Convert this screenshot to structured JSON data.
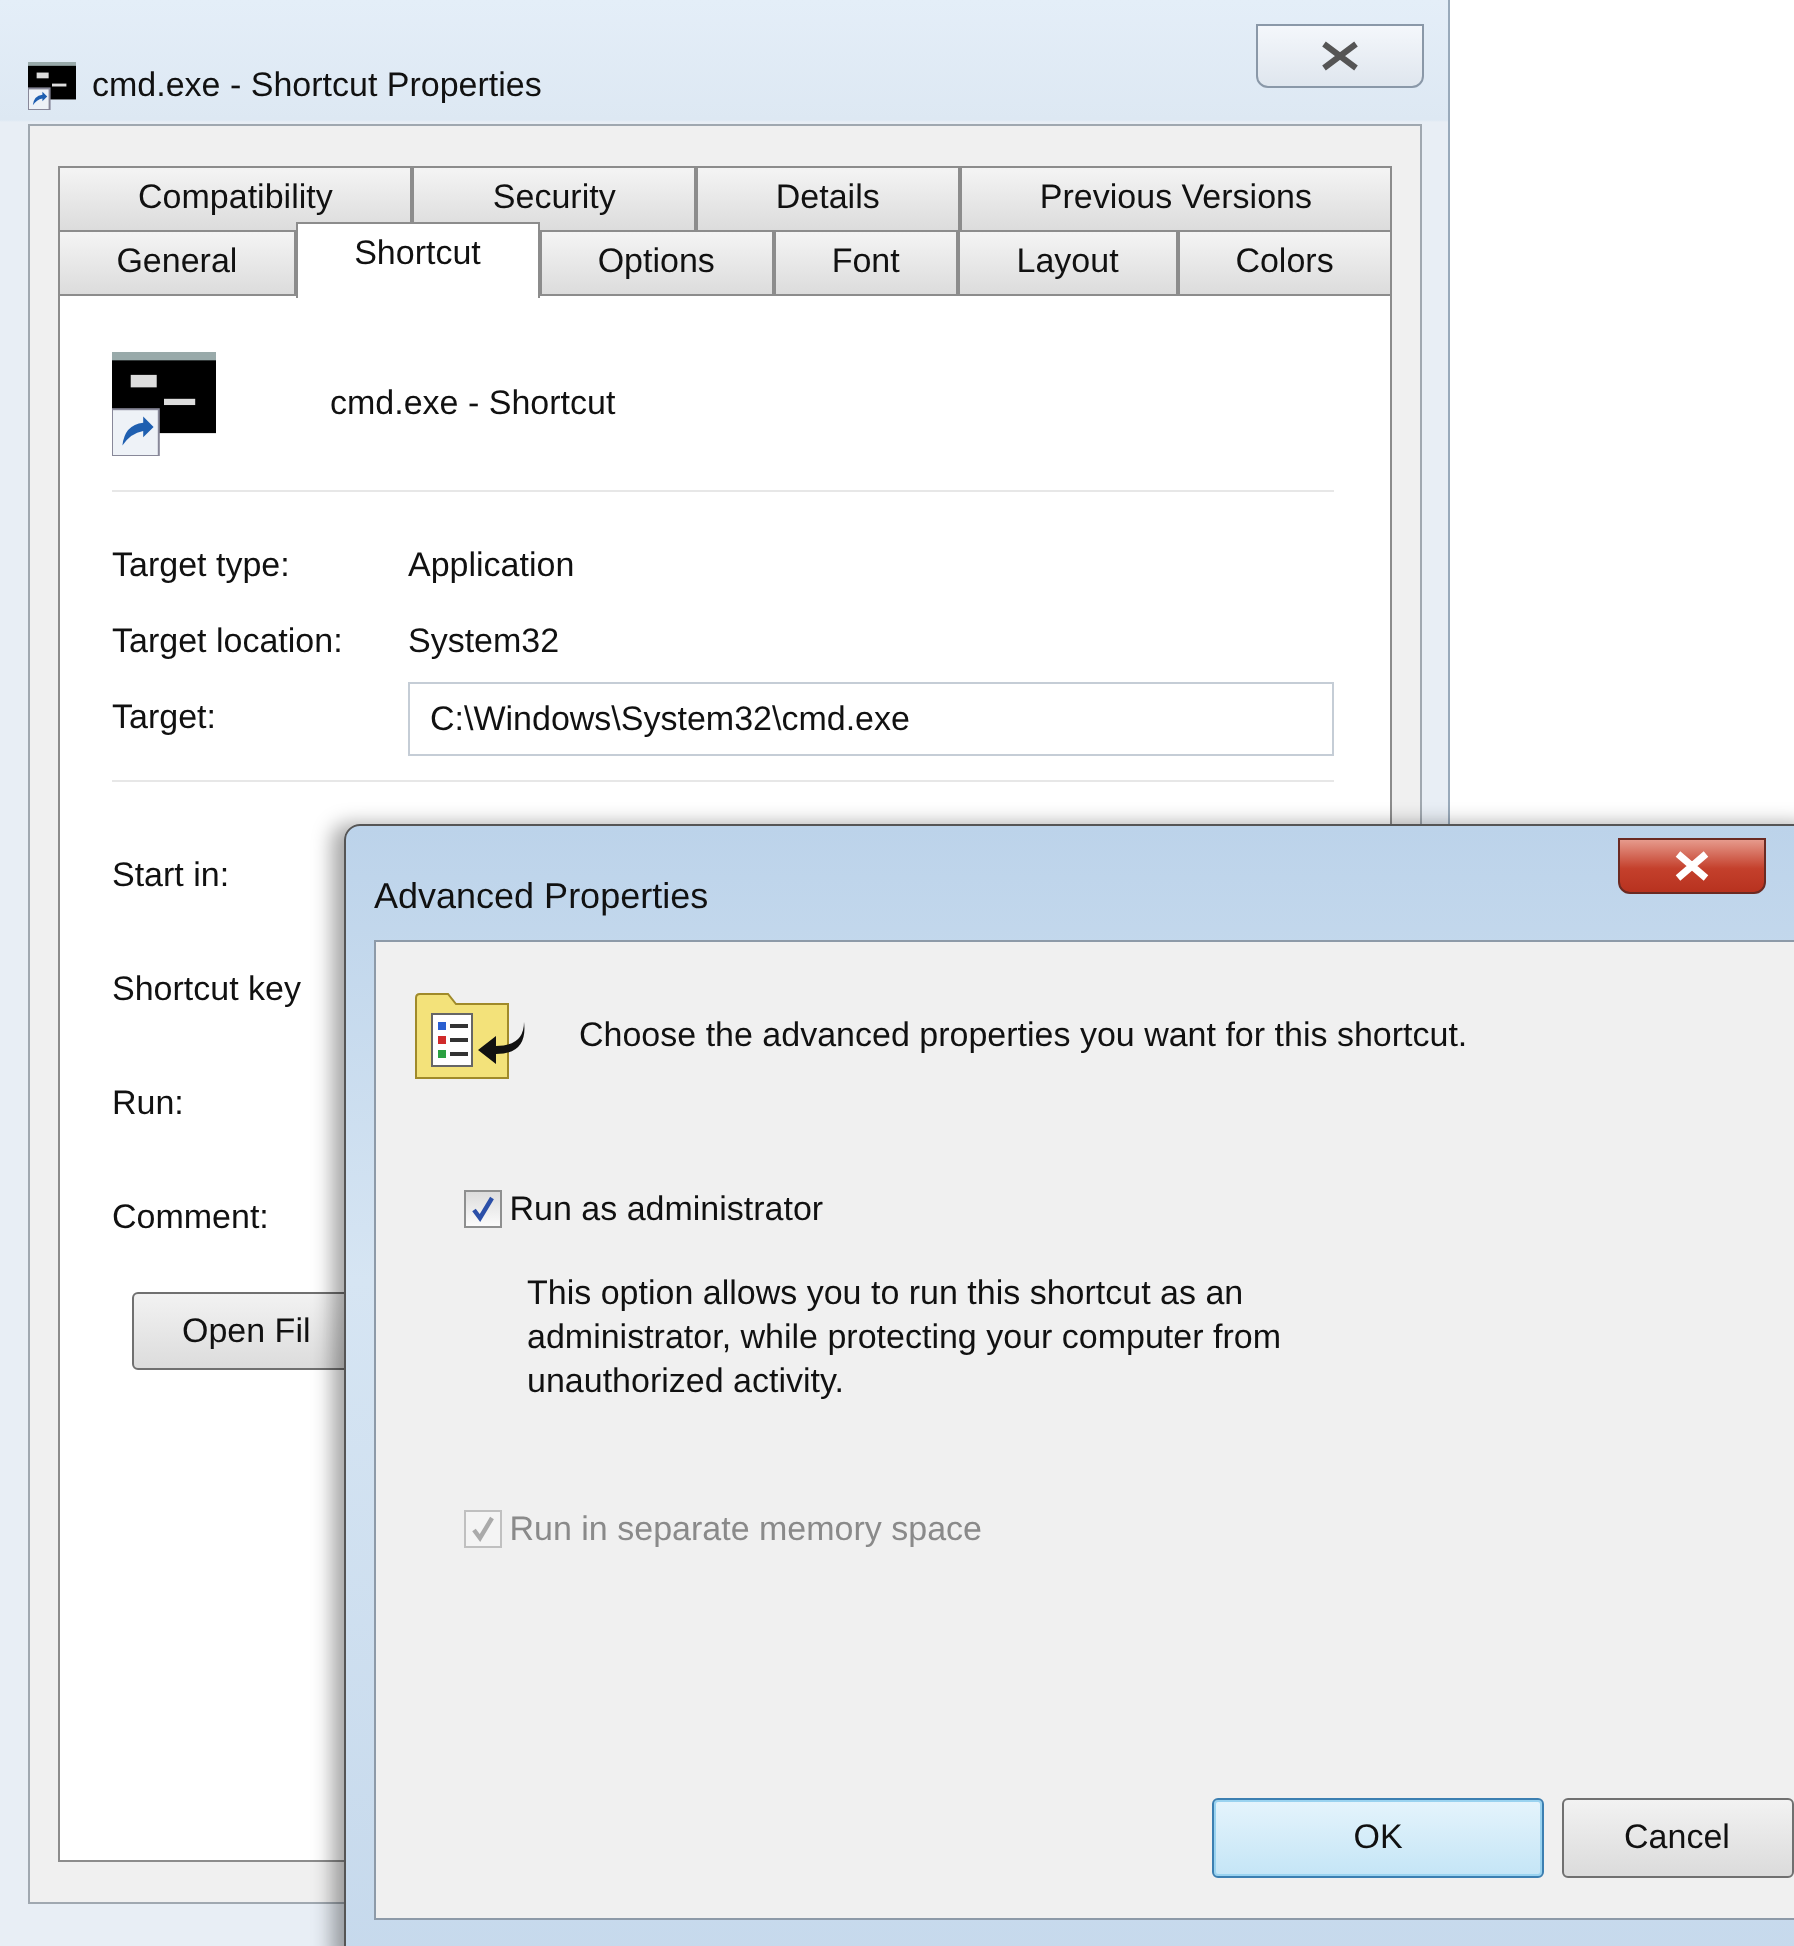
{
  "window": {
    "title": "cmd.exe - Shortcut Properties"
  },
  "tab_rows": [
    {
      "tabs": [
        {
          "label": "Compatibility",
          "selected": false
        },
        {
          "label": "Security",
          "selected": false
        },
        {
          "label": "Details",
          "selected": false
        },
        {
          "label": "Previous Versions",
          "selected": false
        }
      ]
    },
    {
      "tabs": [
        {
          "label": "General",
          "selected": false
        },
        {
          "label": "Shortcut",
          "selected": true
        },
        {
          "label": "Options",
          "selected": false
        },
        {
          "label": "Font",
          "selected": false
        },
        {
          "label": "Layout",
          "selected": false
        },
        {
          "label": "Colors",
          "selected": false
        }
      ]
    }
  ],
  "shortcut": {
    "name": "cmd.exe - Shortcut"
  },
  "sections": [
    {
      "fields": [
        {
          "kind": "text",
          "label": "Target type:",
          "value": "Application"
        },
        {
          "kind": "text",
          "label": "Target location:",
          "value": "System32"
        },
        {
          "kind": "input",
          "label": "Target:",
          "value": "C:\\Windows\\System32\\cmd.exe"
        }
      ]
    },
    {
      "fields": [
        {
          "kind": "label",
          "label": "Start in:"
        },
        {
          "kind": "label",
          "label": "Shortcut key"
        },
        {
          "kind": "label",
          "label": "Run:"
        },
        {
          "kind": "label",
          "label": "Comment:"
        }
      ]
    }
  ],
  "open_file_button": "Open Fil",
  "dialog": {
    "title": "Advanced Properties",
    "intro": "Choose the advanced properties you want for this shortcut.",
    "options": [
      {
        "label": "Run as administrator",
        "checked": true,
        "disabled": false,
        "description": "This option allows you to run this shortcut as an administrator, while protecting your computer from unauthorized activity."
      },
      {
        "label": "Run in separate memory space",
        "checked": true,
        "disabled": true
      }
    ],
    "buttons": [
      {
        "label": "OK",
        "default": true
      },
      {
        "label": "Cancel",
        "default": false
      }
    ]
  }
}
